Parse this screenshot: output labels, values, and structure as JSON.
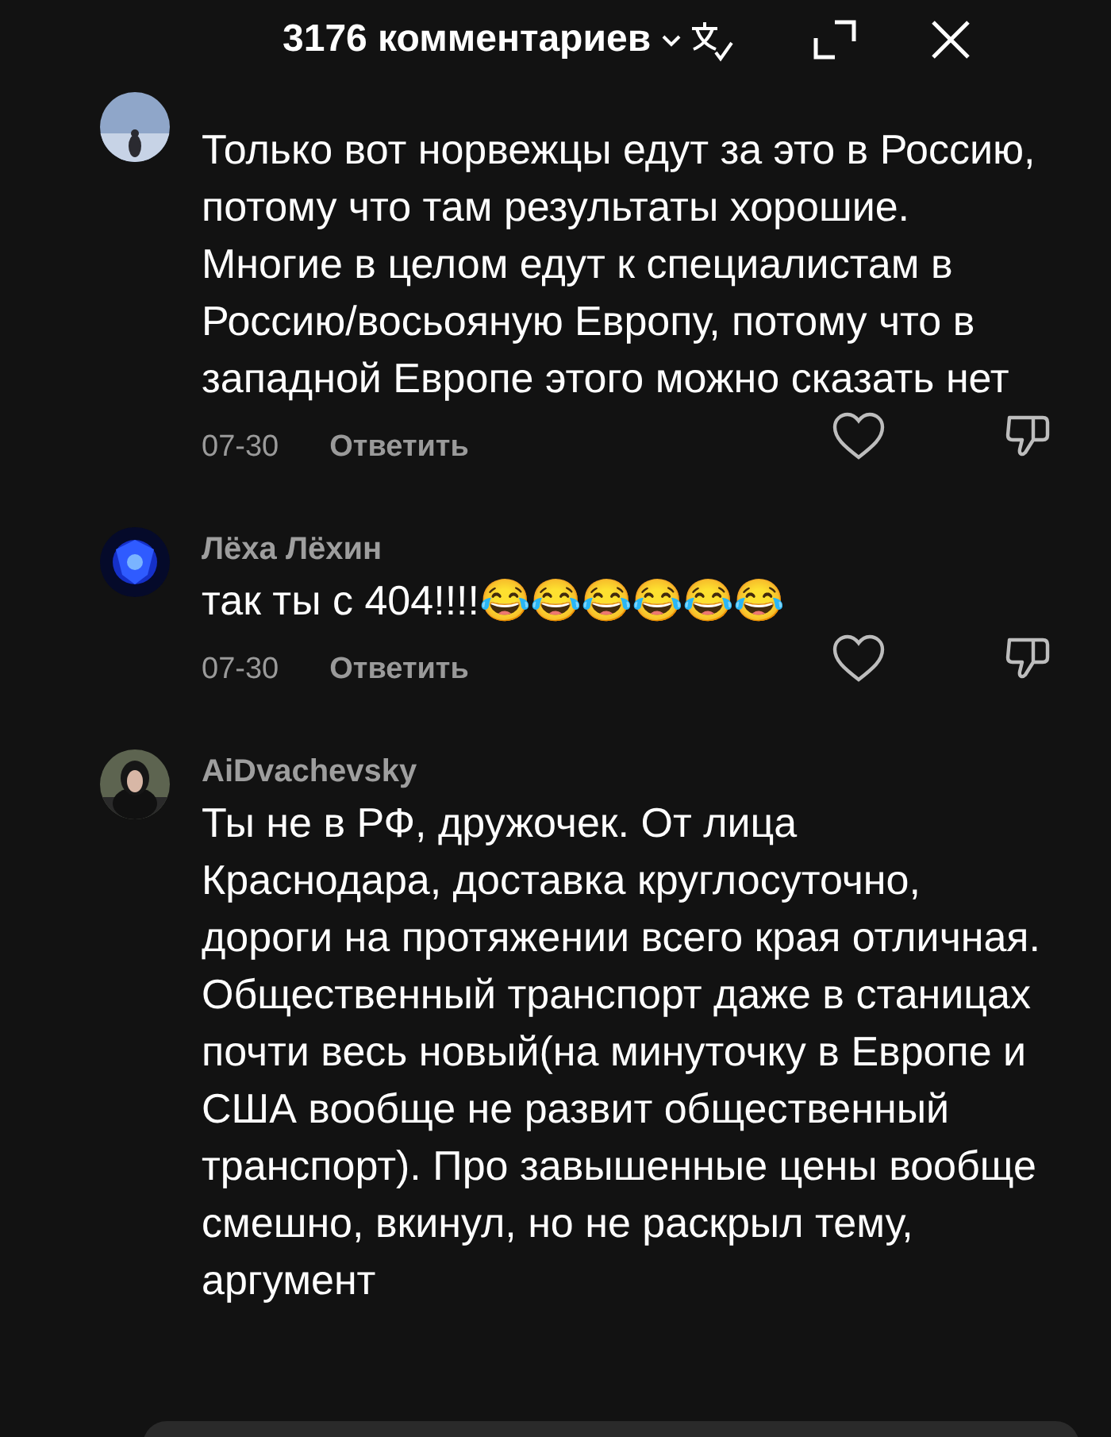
{
  "header": {
    "title": "3176 комментариев"
  },
  "comments": [
    {
      "text": "Только вот норвежцы едут за это в Россию, потому что там результаты хорошие. Многие в целом едут к специалистам в Россию/восьояную Европу, потому что в западной Европе этого можно сказать нет",
      "date": "07-30",
      "reply": "Ответить"
    },
    {
      "author": "Лёха Лёхин",
      "text": "так ты с 404!!!!😂😂😂😂😂😂",
      "date": "07-30",
      "reply": "Ответить"
    },
    {
      "author": "AiDvachevsky",
      "text": "Ты не в РФ, дружочек. От лица Краснодара, доставка круглосуточно, дороги на протяжении всего края отличная. Общественный транспорт даже в станицах почти весь новый(на минуточку в Европе и США вообще не развит общественный транспорт). Про завышенные цены вообще смешно, вкинул, но не раскрыл тему, аргумент"
    }
  ]
}
